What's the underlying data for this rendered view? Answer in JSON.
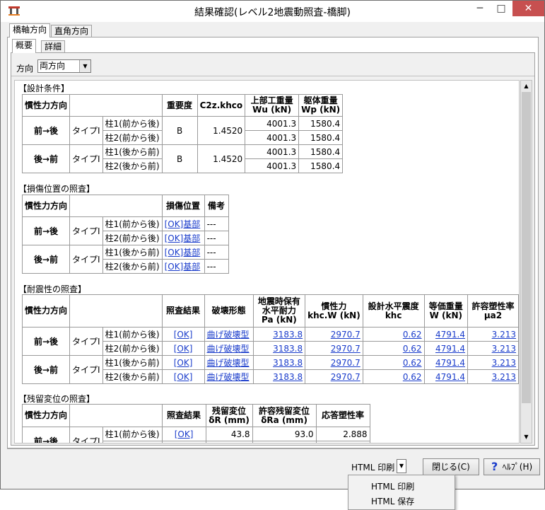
{
  "window": {
    "title": "結果確認(レベル2地震動照査-橋脚)"
  },
  "titlebar": {
    "minimize": "─",
    "maximize": "□",
    "close": "✕"
  },
  "tabs": {
    "outer": [
      "橋軸方向",
      "直角方向"
    ],
    "inner": [
      "概要",
      "詳細"
    ]
  },
  "direction": {
    "label": "方向",
    "value": "両方向"
  },
  "common": {
    "inertia": "慣性力方向",
    "dir_fwd": "前→後",
    "dir_bwd": "後→前",
    "type": "タイプI",
    "col1_fwd": "柱1(前から後)",
    "col2_fwd": "柱2(前から後)",
    "col1_bwd": "柱1(後から前)",
    "col2_bwd": "柱2(後から前)"
  },
  "design": {
    "title": "【設計条件】",
    "h_importance": "重要度",
    "h_c2z": "C2z.khco",
    "h_wu_1": "上部工重量",
    "h_wu_2": "Wu (kN)",
    "h_wp_1": "躯体重量",
    "h_wp_2": "Wp (kN)",
    "rows": [
      {
        "importance": "B",
        "c2z": "1.4520",
        "wu1": "4001.3",
        "wp1": "1580.4",
        "wu2": "4001.3",
        "wp2": "1580.4"
      },
      {
        "importance": "B",
        "c2z": "1.4520",
        "wu1": "4001.3",
        "wp1": "1580.4",
        "wu2": "4001.3",
        "wp2": "1580.4"
      }
    ]
  },
  "damage": {
    "title": "【損傷位置の照査】",
    "h_pos": "損傷位置",
    "h_note": "備考",
    "rows": [
      {
        "pos": "[OK]基部",
        "note": "---"
      },
      {
        "pos": "[OK]基部",
        "note": "---"
      },
      {
        "pos": "[OK]基部",
        "note": "---"
      },
      {
        "pos": "[OK]基部",
        "note": "---"
      }
    ]
  },
  "seismic": {
    "title": "【耐震性の照査】",
    "h_result": "照査結果",
    "h_mode": "破壊形態",
    "h_pa_1": "地震時保有",
    "h_pa_2": "水平耐力",
    "h_pa_3": "Pa (kN)",
    "h_inertia_1": "慣性力",
    "h_inertia_2": "khc.W (kN)",
    "h_khc_1": "設計水平震度",
    "h_khc_2": "khc",
    "h_w_1": "等価重量",
    "h_w_2": "W (kN)",
    "h_mu_1": "許容塑性率",
    "h_mu_2": "μa2",
    "rows": [
      {
        "result": "[OK]",
        "mode": "曲げ破壊型",
        "pa": "3183.8",
        "khcw": "2970.7",
        "khc": "0.62",
        "w": "4791.4",
        "mu": "3.213"
      },
      {
        "result": "[OK]",
        "mode": "曲げ破壊型",
        "pa": "3183.8",
        "khcw": "2970.7",
        "khc": "0.62",
        "w": "4791.4",
        "mu": "3.213"
      },
      {
        "result": "[OK]",
        "mode": "曲げ破壊型",
        "pa": "3183.8",
        "khcw": "2970.7",
        "khc": "0.62",
        "w": "4791.4",
        "mu": "3.213"
      },
      {
        "result": "[OK]",
        "mode": "曲げ破壊型",
        "pa": "3183.8",
        "khcw": "2970.7",
        "khc": "0.62",
        "w": "4791.4",
        "mu": "3.213"
      }
    ]
  },
  "residual": {
    "title": "【残留変位の照査】",
    "h_result": "照査結果",
    "h_dr_1": "残留変位",
    "h_dr_2": "δR (mm)",
    "h_dra_1": "許容残留変位",
    "h_dra_2": "δRa (mm)",
    "h_resp": "応答塑性率",
    "rows": [
      {
        "result": "[OK]",
        "dr": "43.8",
        "dra": "93.0",
        "resp": "2.888"
      }
    ]
  },
  "buttons": {
    "html_label": "HTML 印刷",
    "close": "閉じる(C)",
    "help": "ﾍﾙﾌﾟ(H)"
  },
  "html_menu": [
    "HTML 印刷",
    "HTML 保存"
  ]
}
